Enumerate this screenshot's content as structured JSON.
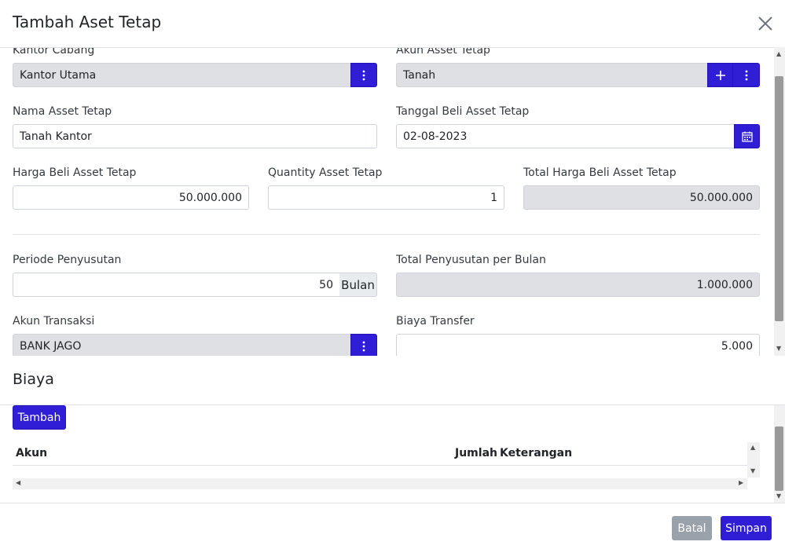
{
  "modal": {
    "title": "Tambah Aset Tetap"
  },
  "form": {
    "kantor_cabang": {
      "label": "Kantor Cabang",
      "value": "Kantor Utama"
    },
    "akun_asset": {
      "label": "Akun Asset Tetap",
      "value": "Tanah"
    },
    "nama_asset": {
      "label": "Nama Asset Tetap",
      "value": "Tanah Kantor"
    },
    "tanggal_beli": {
      "label": "Tanggal Beli Asset Tetap",
      "value": "02-08-2023"
    },
    "harga_beli": {
      "label": "Harga Beli Asset Tetap",
      "value": "50.000.000"
    },
    "quantity": {
      "label": "Quantity Asset Tetap",
      "value": "1"
    },
    "total_harga": {
      "label": "Total Harga Beli Asset Tetap",
      "value": "50.000.000"
    },
    "periode": {
      "label": "Periode Penyusutan",
      "value": "50",
      "unit": "Bulan"
    },
    "total_penyusutan": {
      "label": "Total Penyusutan per Bulan",
      "value": "1.000.000"
    },
    "akun_transaksi": {
      "label": "Akun Transaksi",
      "value": "BANK JAGO"
    },
    "biaya_transfer": {
      "label": "Biaya Transfer",
      "value": "5.000"
    }
  },
  "biaya": {
    "title": "Biaya",
    "add_label": "Tambah",
    "columns": [
      "Akun",
      "Jumlah",
      "Keterangan"
    ]
  },
  "footer": {
    "cancel_label": "Batal",
    "save_label": "Simpan"
  },
  "colors": {
    "primary": "#2f1ed6",
    "readonly_bg": "#dee0e4",
    "cancel_bg": "#99a1aa"
  },
  "icons": [
    "close-icon",
    "kebab-icon",
    "plus-icon",
    "calendar-icon"
  ]
}
